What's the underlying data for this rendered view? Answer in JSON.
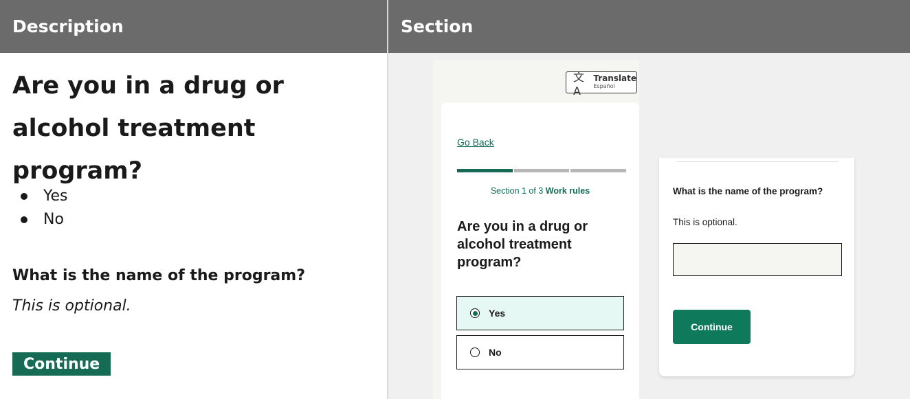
{
  "table": {
    "col1_header": "Description",
    "col2_header": "Section"
  },
  "description": {
    "question": "Are you in a drug or alcohol treatment program?",
    "options": [
      "Yes",
      "No"
    ],
    "program_label": "What is the name of the program?",
    "optional_note": "This is optional.",
    "continue_label": "Continue"
  },
  "preview": {
    "translate_label": "Translate",
    "translate_sublabel": "Español",
    "go_back": "Go Back",
    "progress": {
      "current_section": 1,
      "total_sections": 3
    },
    "section_text": "Section 1 of 3",
    "section_name": "Work rules",
    "question": "Are you in a drug or alcohol treatment program?",
    "option_yes": "Yes",
    "option_no": "No",
    "selected_option": "Yes",
    "program_label": "What is the name of the program?",
    "optional_note": "This is optional.",
    "program_input_value": "",
    "continue_label": "Continue"
  },
  "colors": {
    "header_bg": "#6b6b6b",
    "brand_green": "#156b54",
    "selected_bg": "#e5f8f4"
  }
}
